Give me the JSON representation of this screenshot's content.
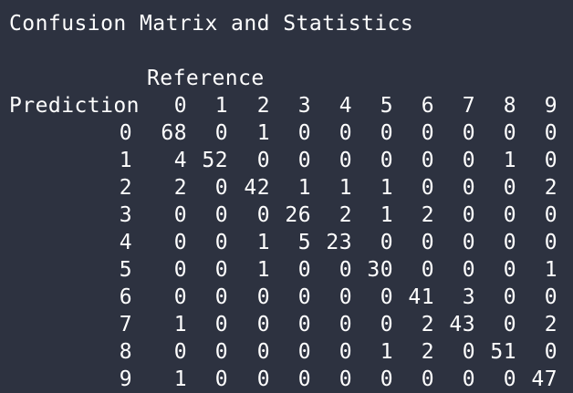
{
  "title": "Confusion Matrix and Statistics",
  "reference_label": "Reference",
  "prediction_label": "Prediction",
  "classes": [
    "0",
    "1",
    "2",
    "3",
    "4",
    "5",
    "6",
    "7",
    "8",
    "9"
  ],
  "matrix": [
    [
      "0",
      [
        "68",
        "0",
        "1",
        "0",
        "0",
        "0",
        "0",
        "0",
        "0",
        "0"
      ]
    ],
    [
      "1",
      [
        "4",
        "52",
        "0",
        "0",
        "0",
        "0",
        "0",
        "0",
        "1",
        "0"
      ]
    ],
    [
      "2",
      [
        "2",
        "0",
        "42",
        "1",
        "1",
        "1",
        "0",
        "0",
        "0",
        "2"
      ]
    ],
    [
      "3",
      [
        "0",
        "0",
        "0",
        "26",
        "2",
        "1",
        "2",
        "0",
        "0",
        "0"
      ]
    ],
    [
      "4",
      [
        "0",
        "0",
        "1",
        "5",
        "23",
        "0",
        "0",
        "0",
        "0",
        "0"
      ]
    ],
    [
      "5",
      [
        "0",
        "0",
        "1",
        "0",
        "0",
        "30",
        "0",
        "0",
        "0",
        "1"
      ]
    ],
    [
      "6",
      [
        "0",
        "0",
        "0",
        "0",
        "0",
        "0",
        "41",
        "3",
        "0",
        "0"
      ]
    ],
    [
      "7",
      [
        "1",
        "0",
        "0",
        "0",
        "0",
        "0",
        "2",
        "43",
        "0",
        "2"
      ]
    ],
    [
      "8",
      [
        "0",
        "0",
        "0",
        "0",
        "0",
        "1",
        "2",
        "0",
        "51",
        "0"
      ]
    ],
    [
      "9",
      [
        "1",
        "0",
        "0",
        "0",
        "0",
        "0",
        "0",
        "0",
        "0",
        "47"
      ]
    ]
  ]
}
